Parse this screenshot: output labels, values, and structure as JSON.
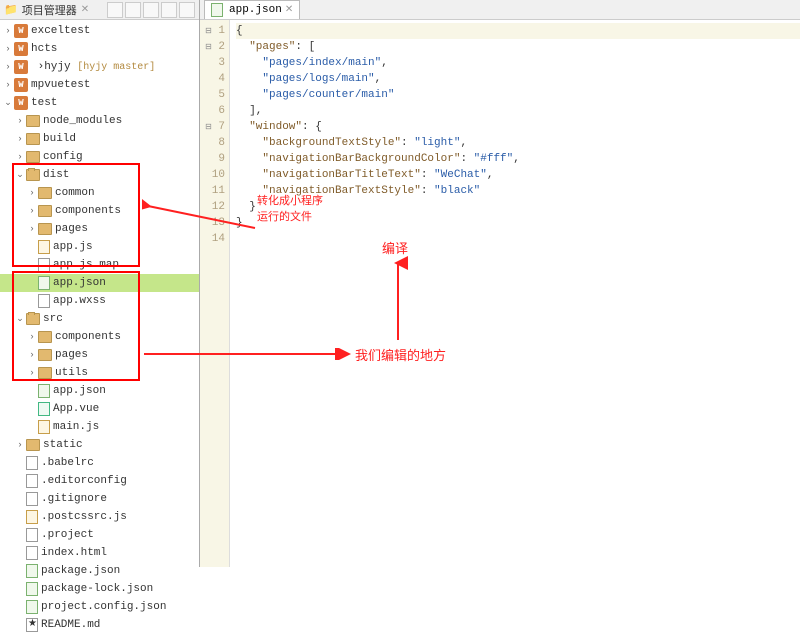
{
  "leftPanel": {
    "title": "项目管理器"
  },
  "tree": {
    "exceltest": "exceltest",
    "hcts": "hcts",
    "hyjy": "hyjy",
    "hyjy_branch": "[hyjy master]",
    "mpvuetest": "mpvuetest",
    "test": "test",
    "node_modules": "node_modules",
    "build": "build",
    "config": "config",
    "dist": "dist",
    "common": "common",
    "components": "components",
    "pages": "pages",
    "app_js": "app.js",
    "app_js_map": "app.js.map",
    "app_json": "app.json",
    "app_wxss": "app.wxss",
    "src": "src",
    "src_components": "components",
    "src_pages": "pages",
    "utils": "utils",
    "src_app_json": "app.json",
    "App_vue": "App.vue",
    "main_js": "main.js",
    "static": "static",
    "babelrc": ".babelrc",
    "editorconfig": ".editorconfig",
    "gitignore": ".gitignore",
    "postcssrc": ".postcssrc.js",
    "project": ".project",
    "index_html": "index.html",
    "package_json": "package.json",
    "package_lock": "package-lock.json",
    "project_config": "project.config.json",
    "readme": "README.md"
  },
  "editorTab": {
    "name": "app.json"
  },
  "code": {
    "l1": "{",
    "l2": "  \"pages\": [",
    "l3": "    \"pages/index/main\",",
    "l4": "    \"pages/logs/main\",",
    "l5": "    \"pages/counter/main\"",
    "l6": "  ],",
    "l7": "  \"window\": {",
    "l8": "    \"backgroundTextStyle\": \"light\",",
    "l9": "    \"navigationBarBackgroundColor\": \"#fff\",",
    "l10": "    \"navigationBarTitleText\": \"WeChat\",",
    "l11": "    \"navigationBarTextStyle\": \"black\"",
    "l12": "  }",
    "l13": "}"
  },
  "ann": {
    "a1_l1": "转化成小程序",
    "a1_l2": "运行的文件",
    "a2": "编译",
    "a3": "我们编辑的地方"
  },
  "lineNumbers": [
    "1",
    "2",
    "3",
    "4",
    "5",
    "6",
    "7",
    "8",
    "9",
    "10",
    "11",
    "12",
    "13",
    "14"
  ]
}
